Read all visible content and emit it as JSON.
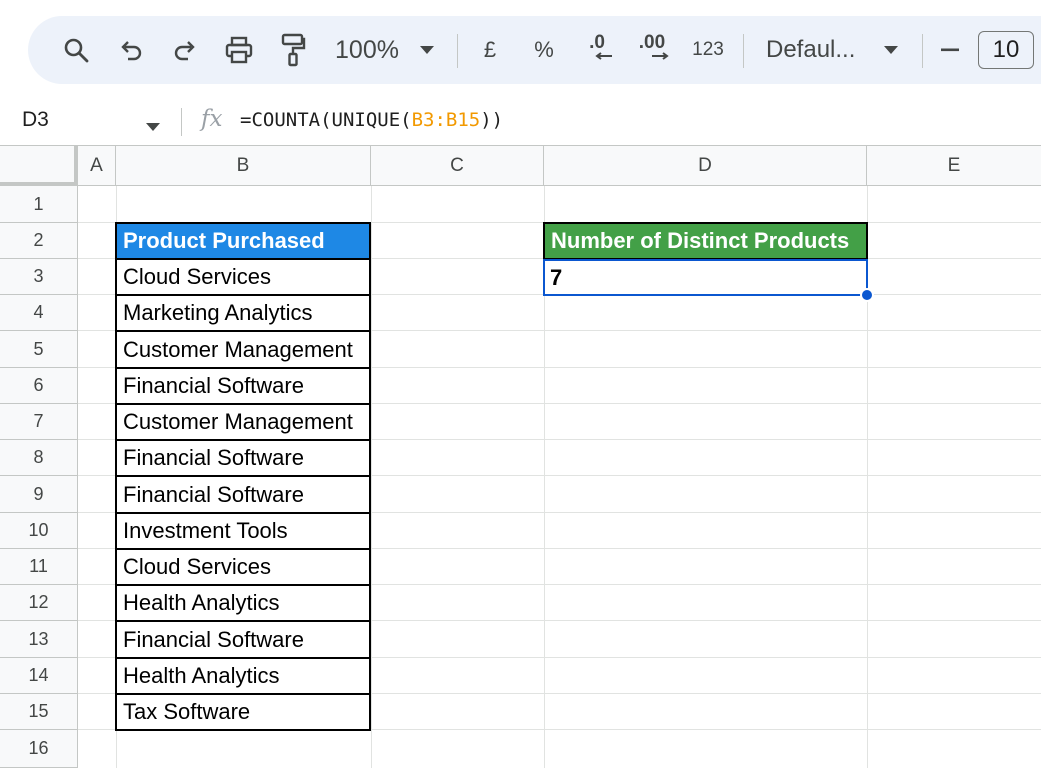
{
  "toolbar": {
    "zoom": "100%",
    "currency": "£",
    "percent": "%",
    "dec_decrease": ".0",
    "dec_increase": ".00",
    "number_format": "123",
    "font": "Defaul...",
    "minus": "—",
    "font_size": "10"
  },
  "formula_bar": {
    "cell_ref": "D3",
    "fx": "fx",
    "formula_prefix": "=COUNTA(UNIQUE(",
    "formula_range": "B3:B15",
    "formula_suffix": "))"
  },
  "columns": [
    "A",
    "B",
    "C",
    "D",
    "E"
  ],
  "rows": [
    "1",
    "2",
    "3",
    "4",
    "5",
    "6",
    "7",
    "8",
    "9",
    "10",
    "11",
    "12",
    "13",
    "14",
    "15",
    "16"
  ],
  "sheet": {
    "b_header": "Product Purchased",
    "products": [
      "Cloud Services",
      "Marketing Analytics",
      "Customer Management",
      "Financial Software",
      "Customer Management",
      "Financial Software",
      "Financial Software",
      "Investment Tools",
      "Cloud Services",
      "Health Analytics",
      "Financial Software",
      "Health Analytics",
      "Tax Software"
    ],
    "d_header": "Number of Distinct Products",
    "d_value": "7"
  },
  "colors": {
    "header_blue": "#1e88e5",
    "header_green": "#43a047",
    "selection": "#0b57d0",
    "range_ref": "#f29900"
  }
}
